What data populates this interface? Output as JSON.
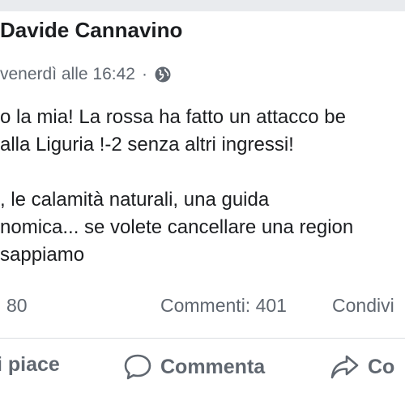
{
  "post": {
    "author": "Davide Cannavino",
    "timestamp": "venerdì alle 16:42",
    "separator": "·",
    "audience_icon": "globe-icon",
    "text_lines": [
      "o la mia! La rossa ha fatto un attacco be",
      "alla Liguria !-2 senza altri ingressi!",
      "",
      ", le calamità naturali, una guida",
      "nomica... se volete cancellare una region",
      "sappiamo"
    ]
  },
  "stats": {
    "likes": "80",
    "comments": "Commenti: 401",
    "shares": "Condivi"
  },
  "actions": {
    "like": "i piace",
    "comment": "Commenta",
    "share": "Co"
  },
  "colors": {
    "text": "#1c1e21",
    "secondary": "#606770",
    "divider": "#dadde1",
    "background_strip": "#e9ebee"
  }
}
